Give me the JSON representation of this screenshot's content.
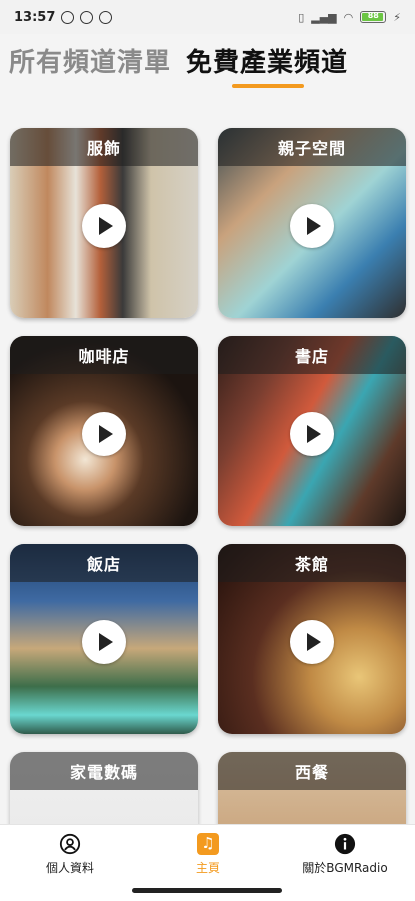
{
  "status_bar": {
    "time": "13:57",
    "battery": "88"
  },
  "tabs": {
    "all_channels": "所有頻道清單",
    "free_channels": "免費產業頻道"
  },
  "channels": [
    {
      "title": "服飾"
    },
    {
      "title": "親子空間"
    },
    {
      "title": "咖啡店"
    },
    {
      "title": "書店"
    },
    {
      "title": "飯店"
    },
    {
      "title": "茶館"
    },
    {
      "title": "家電數碼"
    },
    {
      "title": "西餐"
    }
  ],
  "bottom_nav": {
    "profile": "個人資料",
    "home": "主頁",
    "about": "關於BGMRadio"
  },
  "colors": {
    "accent": "#f39a1f"
  }
}
